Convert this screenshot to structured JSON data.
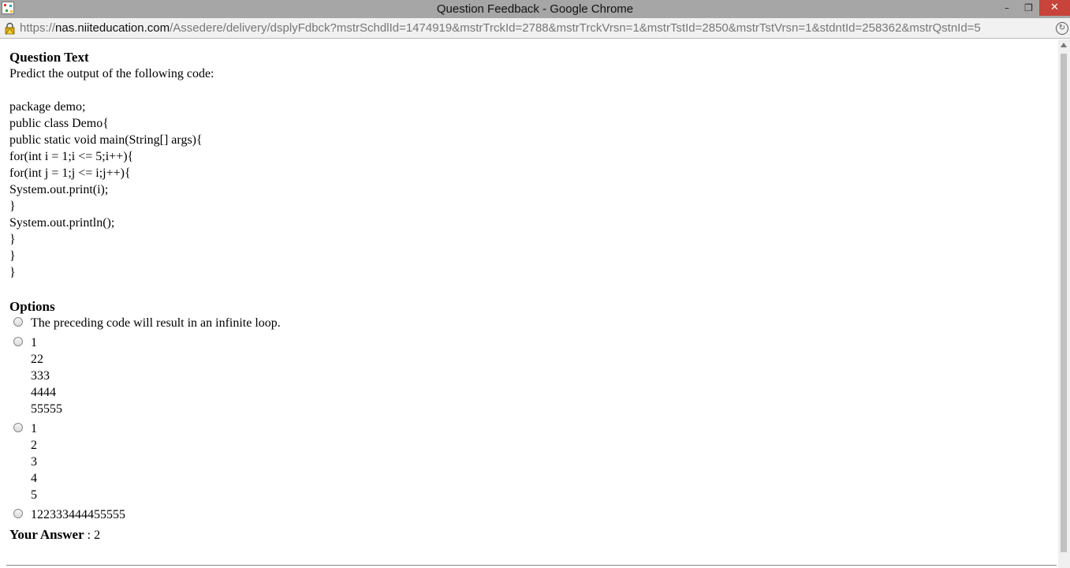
{
  "window": {
    "title": "Question Feedback - Google Chrome",
    "minimize_label": "–",
    "restore_label": "❐",
    "close_label": "✕"
  },
  "address": {
    "protocol": "https://",
    "host": "nas.niiteducation.com",
    "path": "/Assedere/delivery/dsplyFdbck?mstrSchdlId=1474919&mstrTrckId=2788&mstrTrckVrsn=1&mstrTstId=2850&mstrTstVrsn=1&stdntId=258362&mstrQstnId=5"
  },
  "question": {
    "heading": "Question Text",
    "prompt": "Predict the output of the following code:",
    "code_lines": [
      "package demo;",
      "public class Demo{",
      "public static void main(String[] args){",
      "for(int i = 1;i <= 5;i++){",
      "for(int j = 1;j <= i;j++){",
      "System.out.print(i);",
      "}",
      "System.out.println();",
      "}",
      "}",
      "}"
    ]
  },
  "options": {
    "heading": "Options",
    "items": [
      {
        "lines": [
          "The preceding code will result in an infinite loop."
        ]
      },
      {
        "lines": [
          "1",
          "22",
          "333",
          "4444",
          "55555"
        ]
      },
      {
        "lines": [
          "1",
          "2",
          "3",
          "4",
          "5"
        ]
      },
      {
        "lines": [
          "122333444455555"
        ]
      }
    ]
  },
  "answer": {
    "label": "Your Answer",
    "separator": " : ",
    "value": "2"
  }
}
